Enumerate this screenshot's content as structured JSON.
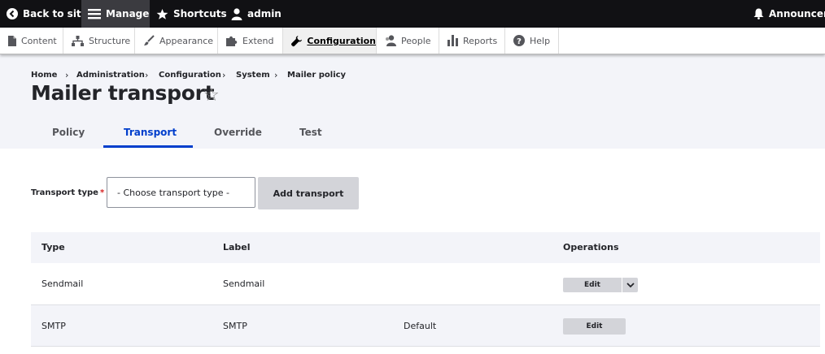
{
  "toolbar": {
    "back_to_site": "Back to site",
    "manage": "Manage",
    "shortcuts": "Shortcuts",
    "user": "admin",
    "announcements": "Announcements"
  },
  "tray": {
    "items": [
      {
        "label": "Content",
        "icon": "file-icon"
      },
      {
        "label": "Structure",
        "icon": "sitemap-icon"
      },
      {
        "label": "Appearance",
        "icon": "brush-icon"
      },
      {
        "label": "Extend",
        "icon": "puzzle-icon"
      },
      {
        "label": "Configuration",
        "icon": "wrench-icon",
        "active": true
      },
      {
        "label": "People",
        "icon": "person-icon"
      },
      {
        "label": "Reports",
        "icon": "bar-chart-icon"
      },
      {
        "label": "Help",
        "icon": "help-icon"
      }
    ]
  },
  "breadcrumb": [
    "Home",
    "Administration",
    "Configuration",
    "System",
    "Mailer policy"
  ],
  "page": {
    "title": "Mailer transport",
    "star": "☆"
  },
  "tabs": [
    {
      "label": "Policy",
      "active": false
    },
    {
      "label": "Transport",
      "active": true
    },
    {
      "label": "Override",
      "active": false
    },
    {
      "label": "Test",
      "active": false
    }
  ],
  "form": {
    "transport_type_label": "Transport type",
    "required_marker": "*",
    "select_value": "- Choose transport type -",
    "add_button": "Add transport"
  },
  "table": {
    "headers": [
      "Type",
      "Label",
      "",
      "Operations"
    ],
    "rows": [
      {
        "type": "Sendmail",
        "label": "Sendmail",
        "default": "",
        "operation": "Edit",
        "has_dropdown": true
      },
      {
        "type": "SMTP",
        "label": "SMTP",
        "default": "Default",
        "operation": "Edit",
        "has_dropdown": false
      }
    ]
  },
  "colors": {
    "toolbar_bg": "#111114",
    "active_tab": "#003ecc",
    "header_bg": "#f3f4f9",
    "button_bg": "#d3d4d9"
  }
}
